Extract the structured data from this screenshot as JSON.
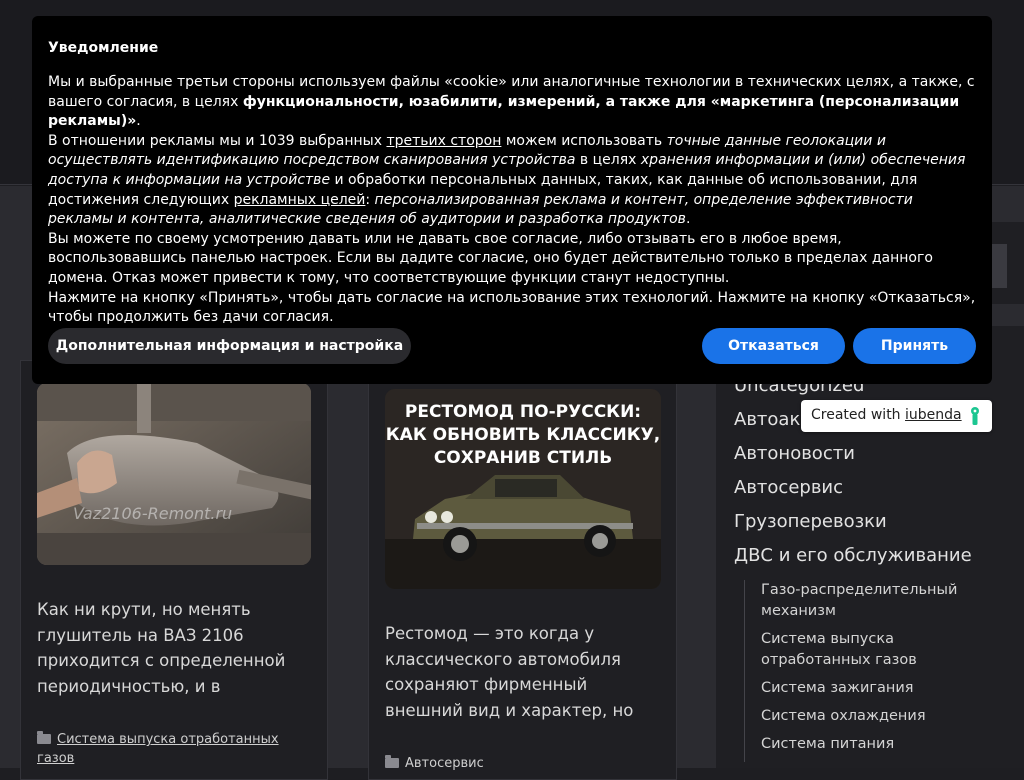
{
  "consent": {
    "title": "Уведомление",
    "p1_a": "Мы и выбранные третьи стороны используем файлы «cookie» или аналогичные технологии в технических целях, а также, с вашего согласия, в целях ",
    "p1_b": "функциональности, юзабилити, измерений, а также для «маркетинга (персонализации рекламы)»",
    "p1_c": ".",
    "p2_a": "В отношении рекламы мы и 1039 выбранных ",
    "p2_link1": "третьих сторон",
    "p2_b": " можем использовать ",
    "p2_i1": "точные данные геолокации и осуществлять идентификацию посредством сканирования устройства",
    "p2_c": " в целях ",
    "p2_i2": "хранения информации и (или) обеспечения доступа к информации на устройстве",
    "p2_d": " и обработки персональных данных, таких, как данные об использовании, для достижения следующих ",
    "p2_link2": "рекламных целей",
    "p2_e": ": ",
    "p2_i3": "персонализированная реклама и контент, определение эффективности рекламы и контента, аналитические сведения об аудитории и разработка продуктов",
    "p2_f": ".",
    "p3": "Вы можете по своему усмотрению давать или не давать свое согласие, либо отзывать его в любое время, воспользовавшись панелью настроек. Если вы дадите согласие, оно будет действительно только в пределах данного домена. Отказ может привести к тому, что соответствующие функции станут недоступны.",
    "p4": "Нажмите на кнопку «Принять», чтобы дать согласие на использование этих технологий. Нажмите на кнопку «Отказаться», чтобы продолжить без дачи согласия.",
    "more_label": "Дополнительная информация и настройка",
    "reject_label": "Отказаться",
    "accept_label": "Принять"
  },
  "badge": {
    "prefix": "Created with ",
    "link": "iubenda"
  },
  "posts": [
    {
      "watermark": "Vaz2106-Remont.ru",
      "excerpt": "Как ни крути, но менять глушитель на ВАЗ 2106 приходится с определенной периодичностью, и в",
      "category": "Система выпуска отработанных газов"
    },
    {
      "image_headline": [
        "РЕСТОМОД ПО-РУССКИ:",
        "КАК ОБНОВИТЬ КЛАССИКУ,",
        "СОХРАНИВ СТИЛЬ"
      ],
      "excerpt": "Рестомод — это когда у классического автомобиля сохраняют фирменный внешний вид и характер, но",
      "category": "Автосервис"
    }
  ],
  "sidebar": {
    "categories": [
      "Uncategorized",
      "Автоаксессуары",
      "Автоновости",
      "Автосервис",
      "Грузоперевозки",
      "ДВС и его обслуживание"
    ],
    "subcategories": [
      "Газо-распределительный механизм",
      "Система выпуска отработанных газов",
      "Система зажигания",
      "Система охлаждения",
      "Система питания"
    ]
  },
  "colors": {
    "accent": "#1a73e8",
    "consent_bg": "#000000",
    "page_bg": "#2b2b30",
    "card_bg": "#1f1f23"
  }
}
